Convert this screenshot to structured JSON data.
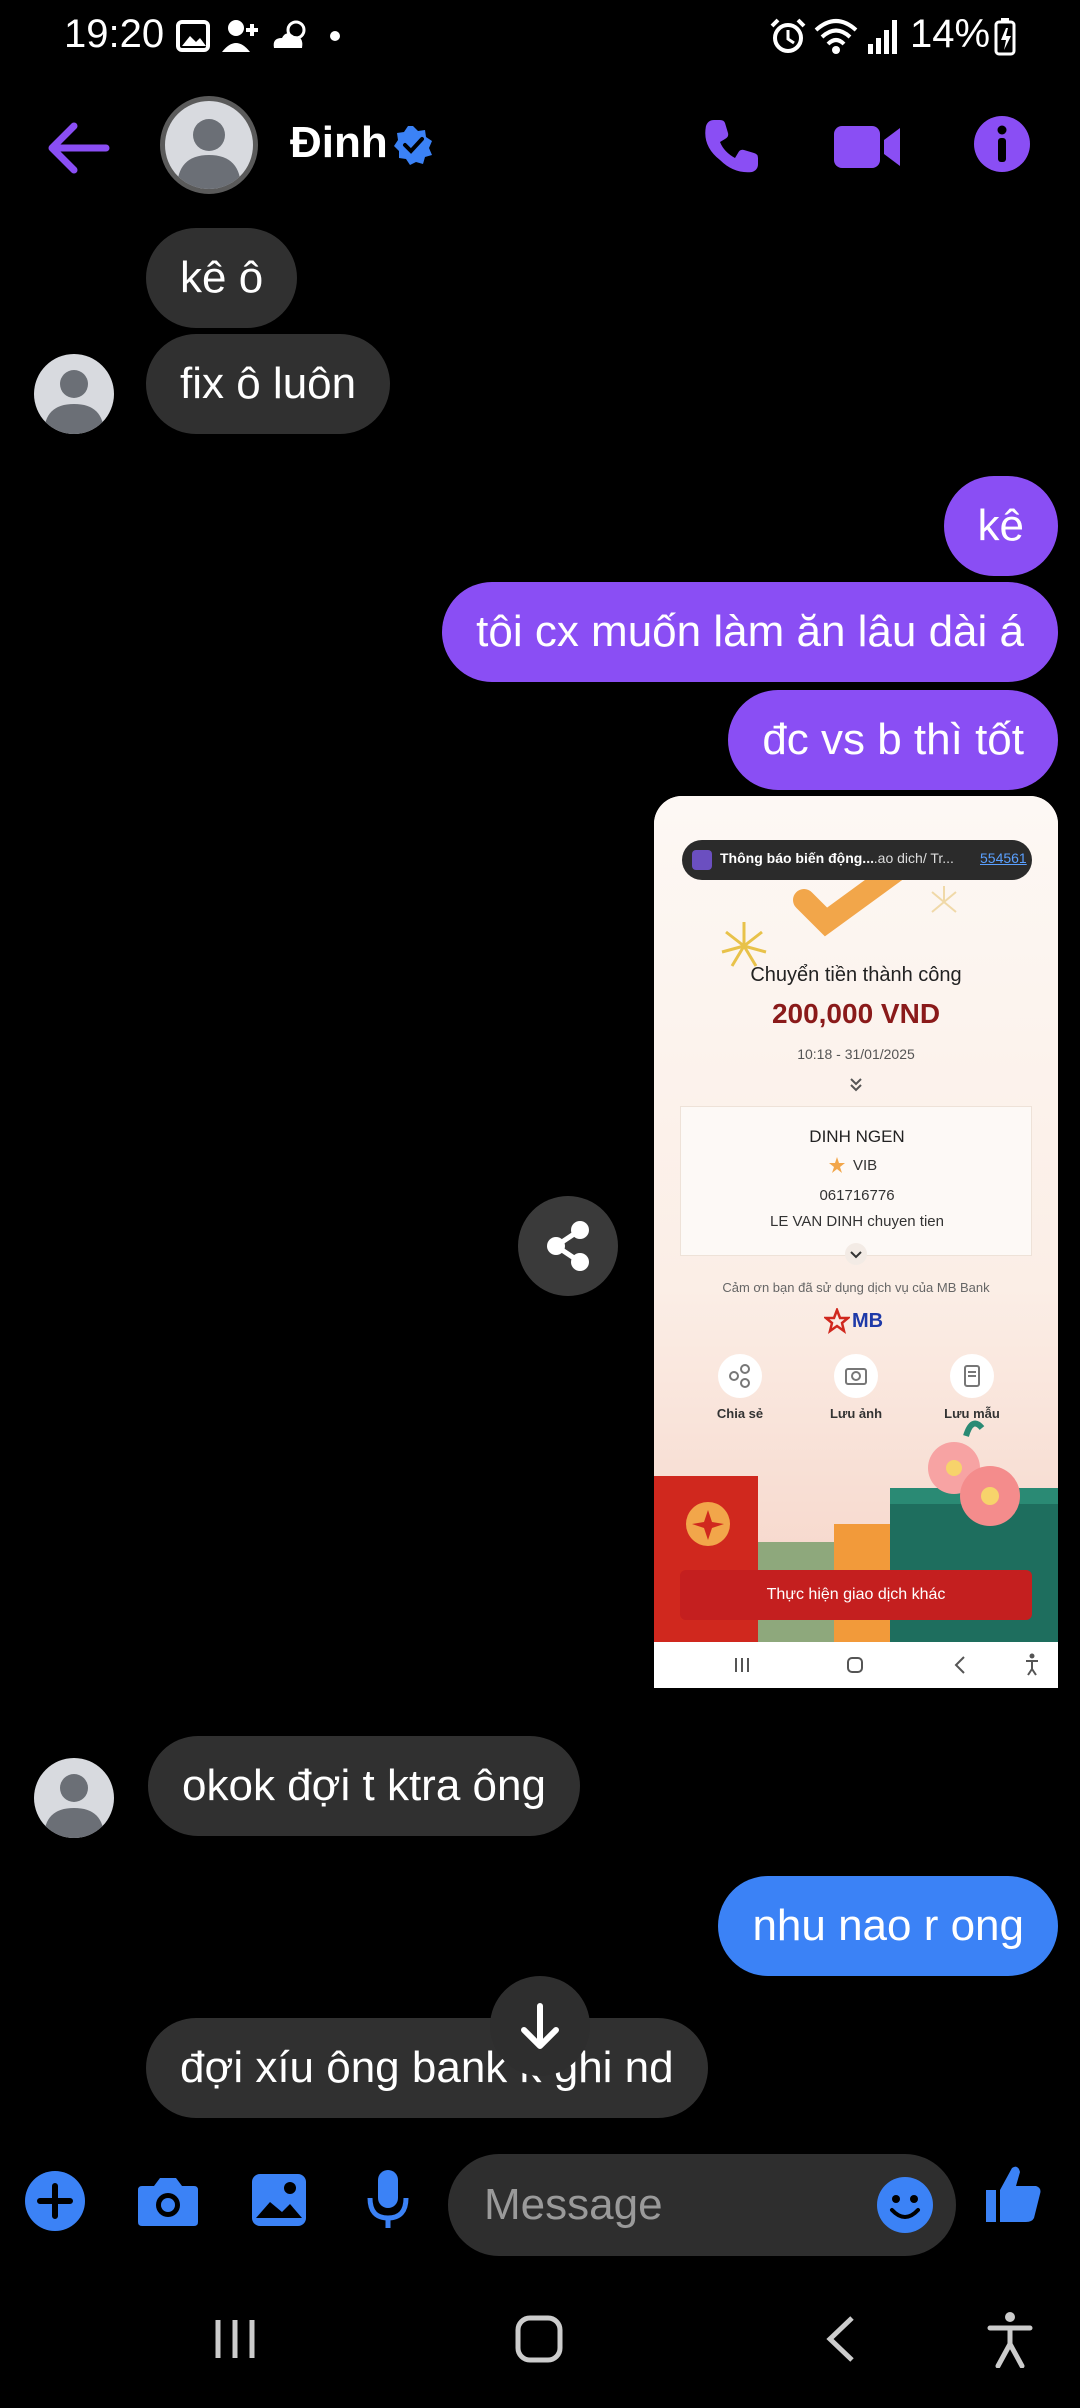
{
  "status_bar": {
    "time": "19:20",
    "battery": "14%"
  },
  "header": {
    "contact_name": "Đinh"
  },
  "messages": [
    {
      "side": "in",
      "text": "kê ô"
    },
    {
      "side": "in",
      "text": "fix ô luôn"
    },
    {
      "side": "out",
      "text": "kê"
    },
    {
      "side": "out",
      "text": "tôi cx muốn làm ăn lâu dài á"
    },
    {
      "side": "out",
      "text": "đc vs b thì tốt"
    },
    {
      "side": "in",
      "text": "okok đợi t ktra ông"
    },
    {
      "side": "out",
      "text": "nhu nao r ong"
    },
    {
      "side": "in",
      "text": "đợi xíu ông bank k ghi nd"
    }
  ],
  "shared_image": {
    "notification": "Thông báo biến động...",
    "notification_mid": "...ao dich/ Tr...",
    "notification_ref": "554561",
    "title": "Chuyển tiền thành công",
    "amount": "200,000 VND",
    "datetime": "10:18 - 31/01/2025",
    "recipient_name": "DINH NGEN",
    "bank": "VIB",
    "account": "061716776",
    "memo": "LE VAN DINH chuyen tien",
    "thanks": "Cảm ơn bạn đã sử dụng dịch vụ của MB Bank",
    "brand": "MB",
    "action_share": "Chia sẻ",
    "action_save_image": "Lưu ảnh",
    "action_save_template": "Lưu mẫu",
    "cta": "Thực hiện giao dịch khác"
  },
  "composer": {
    "placeholder": "Message"
  },
  "colors": {
    "accent": "#8a4ef4",
    "outgoing_purple": "#8a4ef4",
    "outgoing_blue": "#3b82f6",
    "incoming": "#303030",
    "verified": "#3b82f6"
  }
}
